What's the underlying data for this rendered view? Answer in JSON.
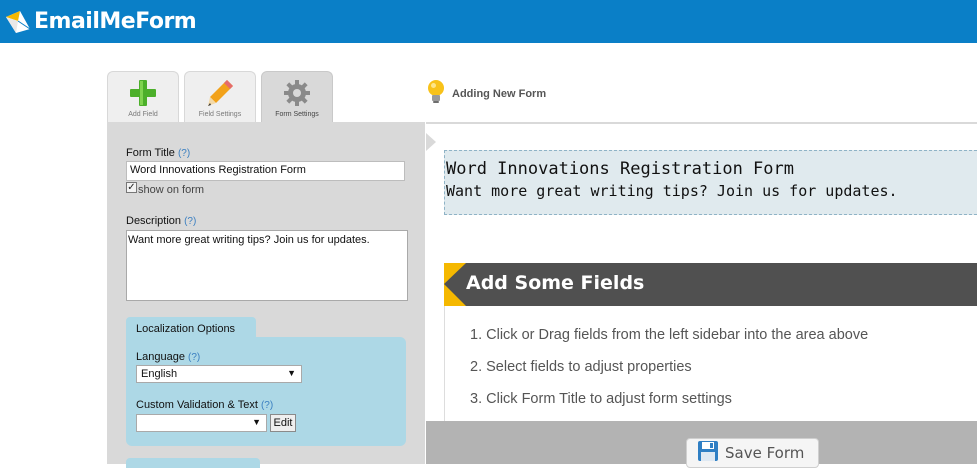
{
  "app": {
    "name": "EmailMeForm"
  },
  "tabs": [
    {
      "label": "Add Field",
      "icon": "plus-icon"
    },
    {
      "label": "Field Settings",
      "icon": "pencil-icon"
    },
    {
      "label": "Form Settings",
      "icon": "gear-icon",
      "active": true
    }
  ],
  "breadcrumb": {
    "text": "Adding New Form",
    "icon": "lightbulb-icon"
  },
  "sidebar": {
    "form_title_label": "Form Title",
    "help_mark": "(?)",
    "form_title_value": "Word Innovations Registration Form",
    "show_on_form_label": "show on form",
    "show_on_form_checked": true,
    "description_label": "Description",
    "description_value": "Want more great writing tips? Join us for updates.",
    "localization": {
      "tab_label": "Localization Options",
      "language_label": "Language",
      "language_value": "English",
      "validation_label": "Custom Validation & Text",
      "validation_value": "",
      "edit_label": "Edit"
    }
  },
  "form_preview": {
    "title": "Word Innovations Registration Form",
    "description": "Want more great writing tips? Join us for updates."
  },
  "fields_area": {
    "banner_title": "Add Some Fields",
    "steps": [
      "1. Click or Drag fields from the left sidebar into the area above",
      "2. Select fields to adjust properties",
      "3. Click Form Title to adjust form settings"
    ]
  },
  "save_button": {
    "label": "Save Form",
    "icon": "floppy-disk-icon"
  },
  "colors": {
    "topbar": "#0a7fc7",
    "accent": "#f5b800",
    "banner": "#505050",
    "localization_panel": "#add8e6"
  }
}
